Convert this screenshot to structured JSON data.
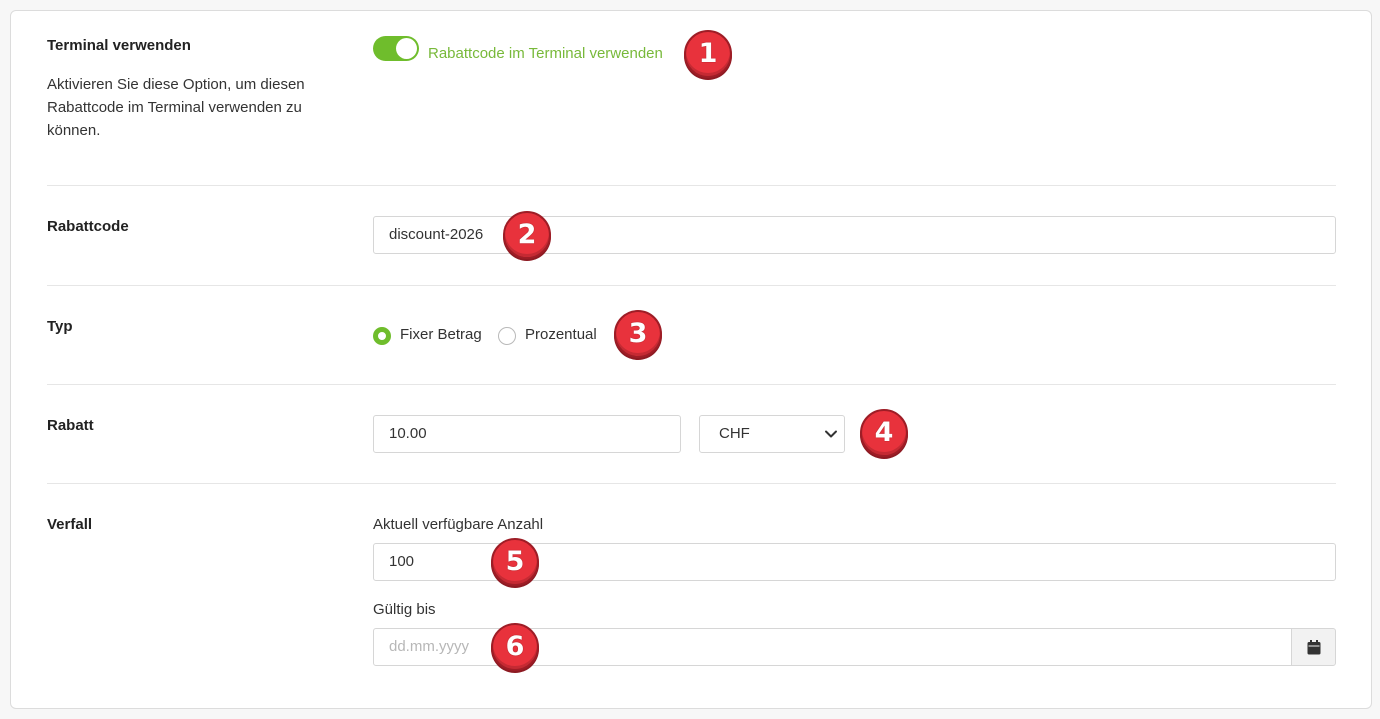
{
  "sections": {
    "terminal": {
      "label": "Terminal verwenden",
      "description": "Aktivieren Sie diese Option, um diesen Rabattcode im Terminal verwenden zu können.",
      "toggle_label": "Rabattcode im Terminal verwenden",
      "toggle_on": true
    },
    "code": {
      "label": "Rabattcode",
      "value": "discount-2026"
    },
    "type": {
      "label": "Typ",
      "options": [
        "Fixer Betrag",
        "Prozentual"
      ],
      "selected": "Fixer Betrag"
    },
    "discount": {
      "label": "Rabatt",
      "value": "10.00",
      "currency": "CHF"
    },
    "expiry": {
      "label": "Verfall",
      "count_caption": "Aktuell verfügbare Anzahl",
      "count_value": "100",
      "valid_caption": "Gültig bis",
      "valid_placeholder": "dd.mm.yyyy"
    }
  },
  "badges": [
    "1",
    "2",
    "3",
    "4",
    "5",
    "6"
  ],
  "colors": {
    "accent": "#6fbd2c",
    "toggle_text": "#78b93a",
    "badge": "#e8323c"
  },
  "icons": {
    "select_arrow": "chevron-down-icon",
    "date_picker": "calendar-icon"
  }
}
